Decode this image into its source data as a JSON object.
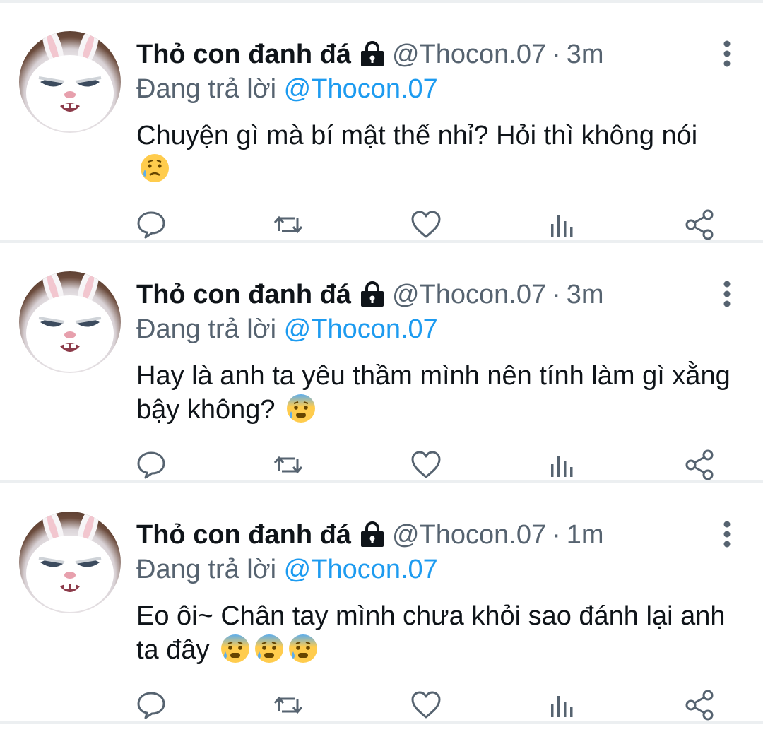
{
  "colors": {
    "text": "#0f1419",
    "secondary": "#566370",
    "link": "#1d9bf0",
    "divider": "#eceff1"
  },
  "icons": [
    "lock-icon",
    "more-icon",
    "reply-icon",
    "retweet-icon",
    "like-icon",
    "views-icon",
    "share-icon",
    "sad-tear-emoji",
    "anxious-sweat-emoji"
  ],
  "tweets": [
    {
      "name": "Thỏ con đanh đá",
      "handle": "@Thocon.07",
      "separator": "·",
      "time": "3m",
      "reply_prefix": "Đang trả lời",
      "reply_to": "@Thocon.07",
      "text": "Chuyện gì mà bí mật thế nhỉ? Hỏi thì không nói",
      "emojis": [
        "sad-tear-emoji"
      ]
    },
    {
      "name": "Thỏ con đanh đá",
      "handle": "@Thocon.07",
      "separator": "·",
      "time": "3m",
      "reply_prefix": "Đang trả lời",
      "reply_to": "@Thocon.07",
      "text": "Hay là anh ta yêu thầm mình nên tính làm gì xằng bậy không?",
      "emojis": [
        "anxious-sweat-emoji"
      ]
    },
    {
      "name": "Thỏ con đanh đá",
      "handle": "@Thocon.07",
      "separator": "·",
      "time": "1m",
      "reply_prefix": "Đang trả lời",
      "reply_to": "@Thocon.07",
      "text": "Eo ôi~ Chân tay mình chưa khỏi sao đánh lại anh ta đây",
      "emojis": [
        "anxious-sweat-emoji",
        "anxious-sweat-emoji",
        "anxious-sweat-emoji"
      ]
    }
  ]
}
